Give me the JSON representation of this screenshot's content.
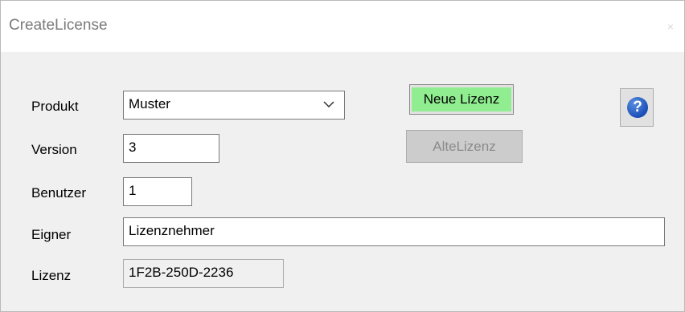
{
  "window": {
    "title": "CreateLicense",
    "close_glyph": "×"
  },
  "form": {
    "produkt_label": "Produkt",
    "produkt_value": "Muster",
    "version_label": "Version",
    "version_value": "3",
    "benutzer_label": "Benutzer",
    "benutzer_value": "1",
    "eigner_label": "Eigner",
    "eigner_value": "Lizenznehmer",
    "lizenz_label": "Lizenz",
    "lizenz_value": "1F2B-250D-2236"
  },
  "buttons": {
    "neue_lizenz": "Neue Lizenz",
    "alte_lizenz": "AlteLizenz",
    "help_glyph": "?"
  },
  "colors": {
    "neue_lizenz_bg": "#90ee90",
    "help_icon": "#1a4fb8",
    "window_bg": "#f0f0f0"
  },
  "icons": [
    "chevron-down-icon",
    "help-icon",
    "close-icon"
  ]
}
